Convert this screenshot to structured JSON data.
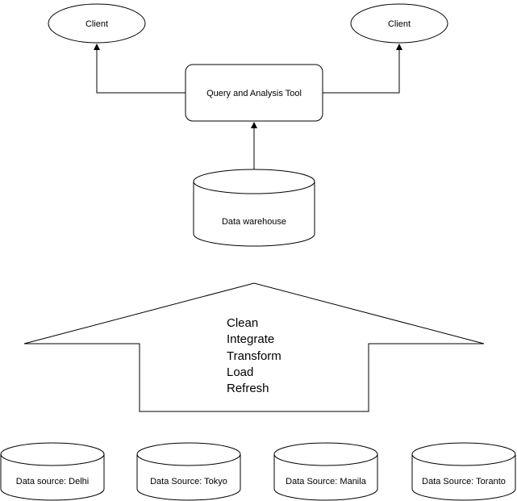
{
  "nodes": {
    "client_left": "Client",
    "client_right": "Client",
    "tool": "Query and Analysis Tool",
    "warehouse": "Data warehouse",
    "process_steps": [
      "Clean",
      "Integrate",
      "Transform",
      "Load",
      "Refresh"
    ],
    "sources": [
      "Data source: Delhi",
      "Data Source: Tokyo",
      "Data Source: Manila",
      "Data Source: Toranto"
    ]
  }
}
